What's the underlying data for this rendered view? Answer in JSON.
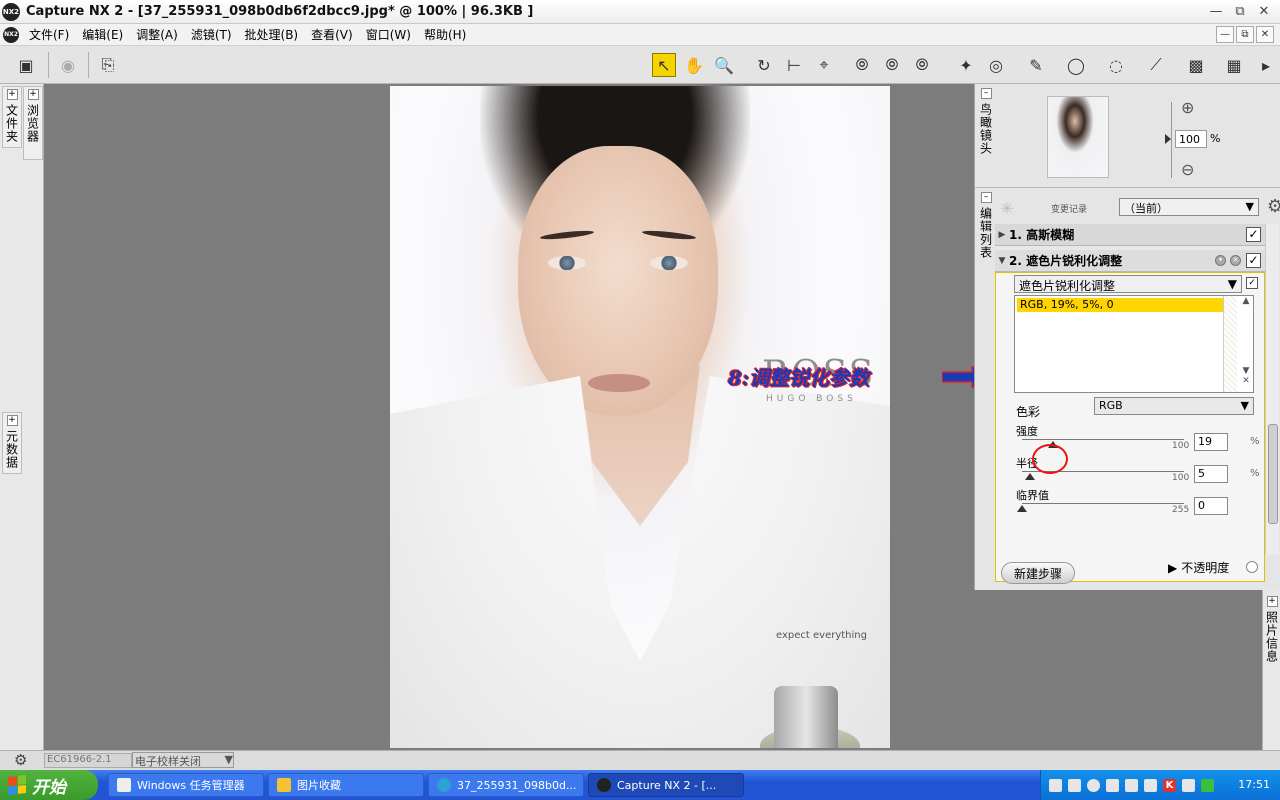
{
  "window": {
    "title": "Capture NX 2 - [37_255931_098b0db6f2dbcc9.jpg* @ 100% | 96.3KB ]",
    "logo": "NX2"
  },
  "menu": {
    "items": [
      "文件(F)",
      "编辑(E)",
      "调整(A)",
      "滤镜(T)",
      "批处理(B)",
      "查看(V)",
      "窗口(W)",
      "帮助(H)"
    ]
  },
  "left_dock": {
    "folders_tab": "文件夹",
    "browser_tab": "浏览器",
    "metadata_tab": "元数据"
  },
  "image": {
    "brand": "BOSS",
    "sub_brand": "HUGO BOSS",
    "tagline": "expect everything"
  },
  "annotation": {
    "text": "8:调整锐化参数"
  },
  "navigator": {
    "tab_label": "鸟瞰镜头",
    "zoom_value": "100",
    "zoom_unit": "%"
  },
  "edit_list": {
    "tab_label": "编辑列表",
    "history_label": "变更记录",
    "history_value": "（当前）",
    "step1": {
      "label": "1. 高斯模糊",
      "checked": "✓"
    },
    "step2": {
      "label": "2. 遮色片锐利化调整",
      "checked": "✓"
    },
    "filter_select": "遮色片锐利化调整",
    "list_selected": "RGB, 19%, 5%, 0",
    "color_label": "色彩",
    "color_value": "RGB",
    "sliders": [
      {
        "label": "强度",
        "value": "19",
        "max": "100",
        "unit": "%",
        "fraction": 0.19
      },
      {
        "label": "半径",
        "value": "5",
        "max": "100",
        "unit": "%",
        "fraction": 0.05
      },
      {
        "label": "临界值",
        "value": "0",
        "max": "255",
        "unit": "",
        "fraction": 0.0
      }
    ],
    "opacity_label": "不透明度",
    "new_step_button": "新建步骤"
  },
  "photo_info": {
    "tab_label": "照片信息"
  },
  "status": {
    "profile_field": "EC61966-2.1",
    "proof_select": "电子校样关闭"
  },
  "taskbar": {
    "start_label": "开始",
    "items": [
      "Windows 任务管理器",
      "图片收藏",
      "37_255931_098b0d...",
      "Capture NX 2 - [..."
    ],
    "clock": "17:51"
  },
  "colors": {
    "highlight": "#ffd400",
    "annotation": "#1c39b8",
    "annotation_outline": "#e22424",
    "taskbar": "#2454d6"
  }
}
